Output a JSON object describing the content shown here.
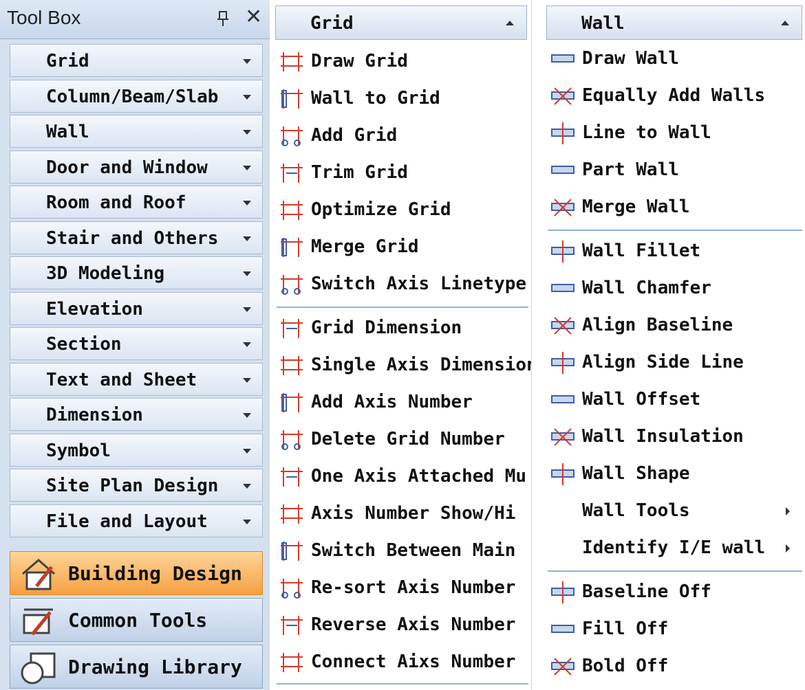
{
  "toolbox": {
    "title": "Tool Box",
    "categories": [
      {
        "label": "Grid"
      },
      {
        "label": "Column/Beam/Slab"
      },
      {
        "label": "Wall"
      },
      {
        "label": "Door and Window"
      },
      {
        "label": "Room and Roof"
      },
      {
        "label": "Stair and Others"
      },
      {
        "label": "3D Modeling"
      },
      {
        "label": "Elevation"
      },
      {
        "label": "Section"
      },
      {
        "label": "Text and Sheet"
      },
      {
        "label": "Dimension"
      },
      {
        "label": "Symbol"
      },
      {
        "label": "Site Plan Design"
      },
      {
        "label": "File and Layout"
      }
    ],
    "buttons": {
      "building": "Building Design",
      "common": "Common Tools",
      "library": "Drawing Library"
    }
  },
  "grid_menu": {
    "title": "Grid",
    "items": [
      {
        "label": "Draw Grid",
        "icon": "draw-grid-icon"
      },
      {
        "label": "Wall to Grid",
        "icon": "wall-to-grid-icon"
      },
      {
        "label": "Add Grid",
        "icon": "add-grid-icon"
      },
      {
        "label": "Trim Grid",
        "icon": "trim-grid-icon"
      },
      {
        "label": "Optimize Grid",
        "icon": "optimize-grid-icon"
      },
      {
        "label": "Merge Grid",
        "icon": "merge-grid-icon"
      },
      {
        "label": "Switch Axis Linetype",
        "icon": "switch-linetype-icon"
      },
      {
        "label": "Grid Dimension",
        "icon": "grid-dimension-icon"
      },
      {
        "label": "Single Axis Dimension",
        "icon": "single-axis-dimension-icon"
      },
      {
        "label": "Add Axis Number",
        "icon": "add-axis-number-icon"
      },
      {
        "label": "Delete Grid Number",
        "icon": "delete-grid-number-icon"
      },
      {
        "label": "One Axis Attached Mu",
        "icon": "one-axis-attached-icon"
      },
      {
        "label": "Axis Number Show/Hi",
        "icon": "axis-number-show-icon"
      },
      {
        "label": "Switch Between Main",
        "icon": "switch-between-main-icon"
      },
      {
        "label": "Re-sort Axis Number",
        "icon": "resort-axis-number-icon"
      },
      {
        "label": "Reverse Axis Number",
        "icon": "reverse-axis-number-icon"
      },
      {
        "label": "Connect Aixs Number",
        "icon": "connect-axis-number-icon"
      }
    ]
  },
  "wall_menu": {
    "title": "Wall",
    "items": [
      {
        "label": "Draw Wall",
        "icon": "draw-wall-icon"
      },
      {
        "label": "Equally Add Walls",
        "icon": "equally-add-walls-icon"
      },
      {
        "label": "Line to Wall",
        "icon": "line-to-wall-icon"
      },
      {
        "label": "Part Wall",
        "icon": "part-wall-icon"
      },
      {
        "label": "Merge Wall",
        "icon": "merge-wall-icon"
      },
      {
        "label": "Wall Fillet",
        "icon": "wall-fillet-icon"
      },
      {
        "label": "Wall Chamfer",
        "icon": "wall-chamfer-icon"
      },
      {
        "label": "Align Baseline",
        "icon": "align-baseline-icon"
      },
      {
        "label": "Align Side Line",
        "icon": "align-side-line-icon"
      },
      {
        "label": "Wall Offset",
        "icon": "wall-offset-icon"
      },
      {
        "label": "Wall Insulation",
        "icon": "wall-insulation-icon"
      },
      {
        "label": "Wall Shape",
        "icon": "wall-shape-icon"
      },
      {
        "label": "Wall Tools",
        "icon": ""
      },
      {
        "label": "Identify I/E wall",
        "icon": ""
      },
      {
        "label": "Baseline Off",
        "icon": "baseline-off-icon"
      },
      {
        "label": "Fill Off",
        "icon": "fill-off-icon"
      },
      {
        "label": "Bold Off",
        "icon": "bold-off-icon"
      }
    ]
  }
}
